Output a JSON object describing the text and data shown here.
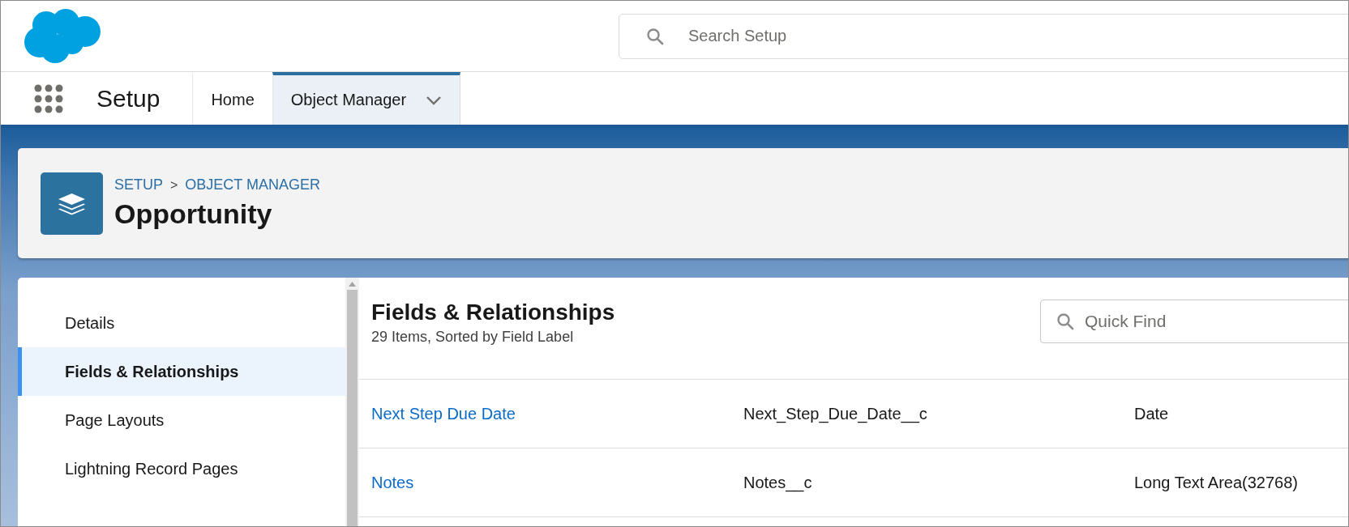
{
  "header": {
    "search": {
      "placeholder": "Search Setup"
    }
  },
  "nav": {
    "app_name": "Setup",
    "tabs": [
      {
        "label": "Home",
        "selected": false,
        "dropdown": false
      },
      {
        "label": "Object Manager",
        "selected": true,
        "dropdown": true
      }
    ]
  },
  "object_header": {
    "breadcrumb": [
      "SETUP",
      "OBJECT MANAGER"
    ],
    "separator": ">",
    "title": "Opportunity"
  },
  "sidebar": {
    "items": [
      {
        "label": "Details",
        "selected": false
      },
      {
        "label": "Fields & Relationships",
        "selected": true
      },
      {
        "label": "Page Layouts",
        "selected": false
      },
      {
        "label": "Lightning Record Pages",
        "selected": false
      }
    ]
  },
  "content": {
    "title": "Fields & Relationships",
    "subtitle": "29 Items, Sorted by Field Label",
    "quick_find": {
      "placeholder": "Quick Find"
    },
    "rows": [
      {
        "field_label": "Next Step Due Date",
        "api_name": "Next_Step_Due_Date__c",
        "data_type": "Date"
      },
      {
        "field_label": "Notes",
        "api_name": "Notes__c",
        "data_type": "Long Text Area(32768)"
      }
    ]
  }
}
